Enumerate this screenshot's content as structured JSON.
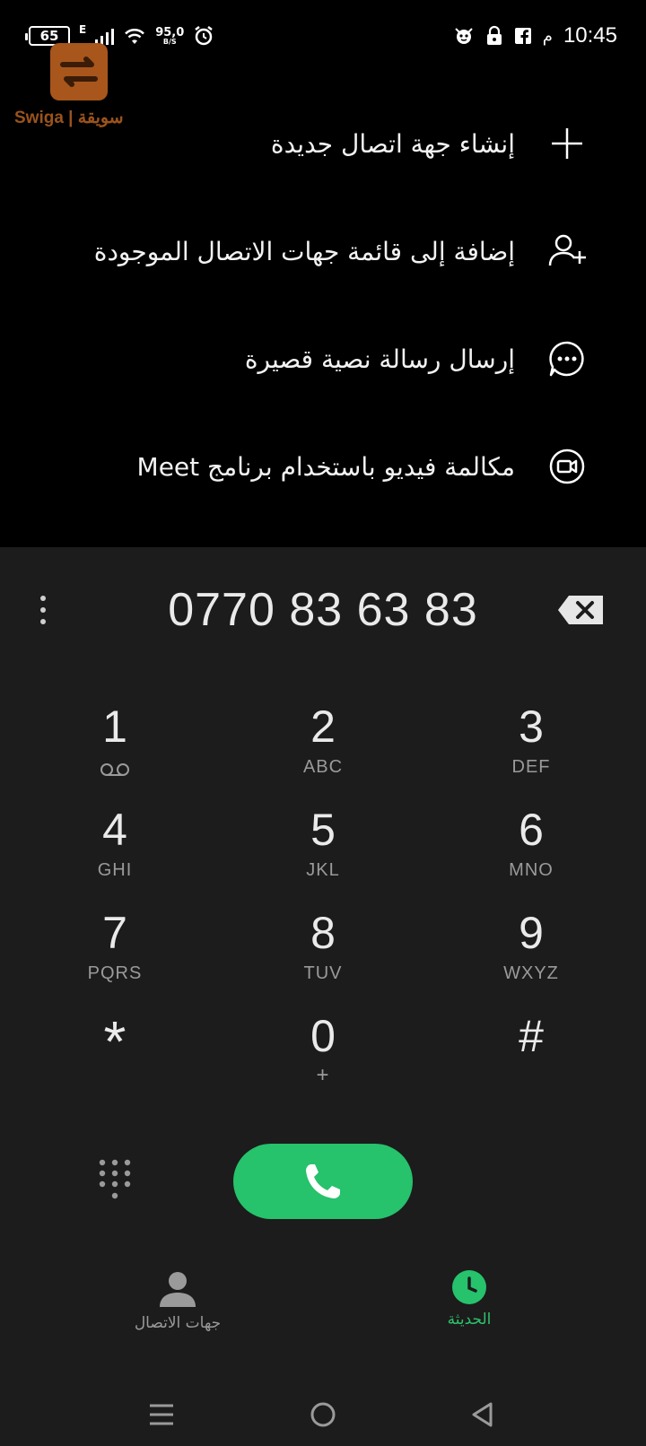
{
  "status_bar": {
    "battery": "65",
    "network_type": "E",
    "speed_value": "95,0",
    "speed_unit": "B/S",
    "time": "10:45",
    "ampm": "م"
  },
  "watermark": {
    "text": "Swiga | سويقة"
  },
  "menu": {
    "items": [
      {
        "label": "إنشاء جهة اتصال جديدة",
        "icon": "plus-icon"
      },
      {
        "label": "إضافة إلى قائمة جهات الاتصال الموجودة",
        "icon": "add-person-icon"
      },
      {
        "label": "إرسال رسالة نصية قصيرة",
        "icon": "message-icon"
      },
      {
        "label": "مكالمة فيديو باستخدام برنامج Meet",
        "icon": "video-call-icon"
      }
    ]
  },
  "dialer": {
    "number": "0770 83 63 83",
    "keys": [
      {
        "digit": "1",
        "letters": ""
      },
      {
        "digit": "2",
        "letters": "ABC"
      },
      {
        "digit": "3",
        "letters": "DEF"
      },
      {
        "digit": "4",
        "letters": "GHI"
      },
      {
        "digit": "5",
        "letters": "JKL"
      },
      {
        "digit": "6",
        "letters": "MNO"
      },
      {
        "digit": "7",
        "letters": "PQRS"
      },
      {
        "digit": "8",
        "letters": "TUV"
      },
      {
        "digit": "9",
        "letters": "WXYZ"
      },
      {
        "digit": "*",
        "letters": ""
      },
      {
        "digit": "0",
        "letters": "+"
      },
      {
        "digit": "#",
        "letters": ""
      }
    ]
  },
  "tabs": {
    "contacts": "جهات الاتصال",
    "recent": "الحديثة"
  },
  "colors": {
    "accent_green": "#26c26c",
    "panel": "#1c1c1c",
    "background": "#000000"
  }
}
